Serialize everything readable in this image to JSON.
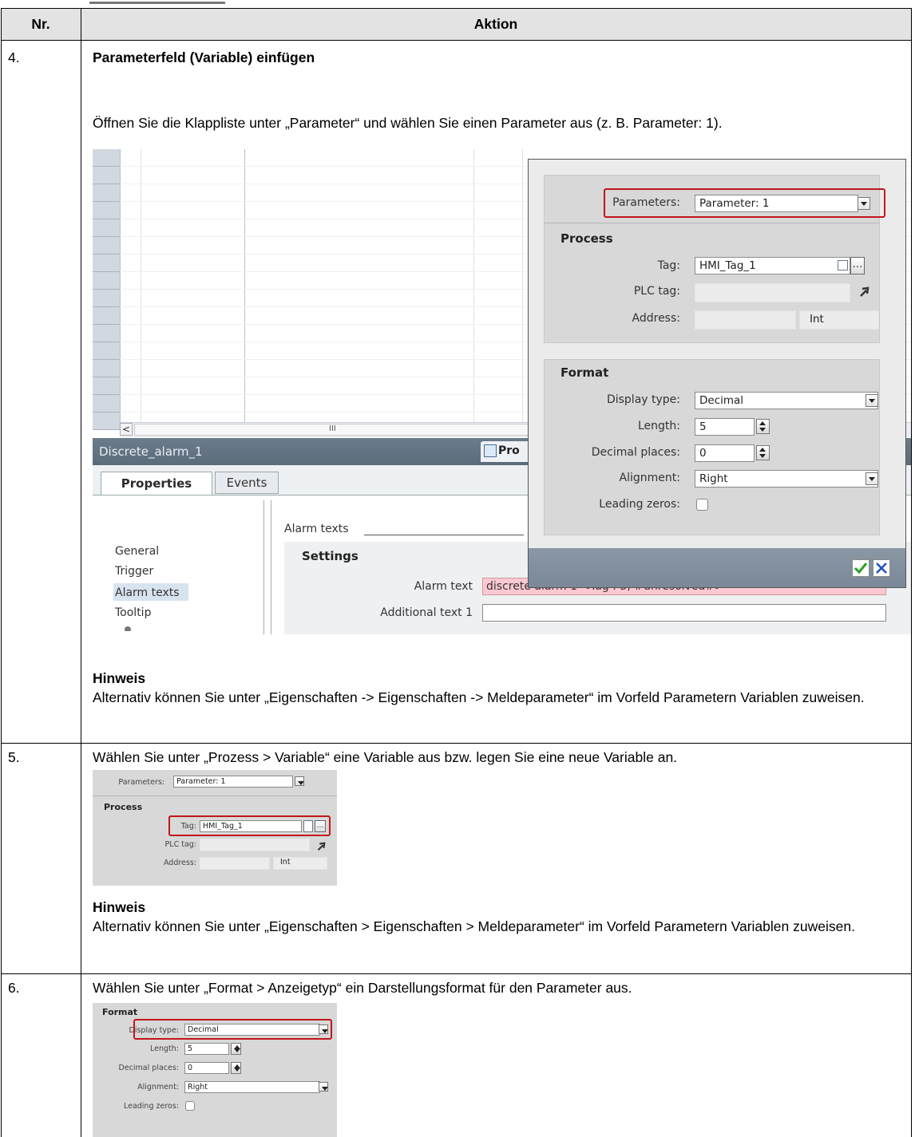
{
  "table": {
    "header": {
      "nr": "Nr.",
      "aktion": "Aktion"
    },
    "rows": [
      {
        "nr": "4.",
        "title": "Parameterfeld (Variable) einfügen",
        "text": "Öffnen Sie die Klappliste unter „Parameter“ und wählen Sie einen Parameter aus (z. B. Parameter: 1).",
        "note_title": "Hinweis",
        "note": "Alternativ können Sie unter „Eigenschaften -> Eigenschaften -> Meldeparameter“ im Vorfeld Parametern Variablen zuweisen."
      },
      {
        "nr": "5.",
        "text": "Wählen Sie unter „Prozess > Variable“ eine Variable aus bzw. legen Sie eine neue Variable an.",
        "note_title": "Hinweis",
        "note": "Alternativ können Sie unter „Eigenschaften > Eigenschaften > Meldeparameter“ im Vorfeld Parametern Variablen zuweisen."
      },
      {
        "nr": "6.",
        "text": "Wählen Sie unter „Format > Anzeigetyp“ ein Darstellungsformat für den Parameter aus."
      }
    ]
  },
  "screenshot": {
    "alarm_name": "Discrete_alarm_1",
    "header_tab": "Pro",
    "tabs": [
      "Properties",
      "Events"
    ],
    "nav": [
      "General",
      "Trigger",
      "Alarm texts",
      "Tooltip"
    ],
    "group_title": "Alarm texts",
    "settings": "Settings",
    "alarm_text_label": "Alarm text",
    "alarm_text_value": "discrete alarm 1 <Tag : 5, #unresolved#>",
    "additional_text_label": "Additional text 1",
    "scroll_marker": "III"
  },
  "popup": {
    "parameters_label": "Parameters:",
    "parameters_value": "Parameter: 1",
    "process_title": "Process",
    "tag_label": "Tag:",
    "tag_value": "HMI_Tag_1",
    "plc_tag_label": "PLC tag:",
    "address_label": "Address:",
    "address_type": "Int",
    "format_title": "Format",
    "display_type_label": "Display type:",
    "display_type_value": "Decimal",
    "length_label": "Length:",
    "length_value": "5",
    "decimal_places_label": "Decimal places:",
    "decimal_places_value": "0",
    "alignment_label": "Alignment:",
    "alignment_value": "Right",
    "leading_zeros_label": "Leading zeros:",
    "leading_zeros_checked": false
  }
}
